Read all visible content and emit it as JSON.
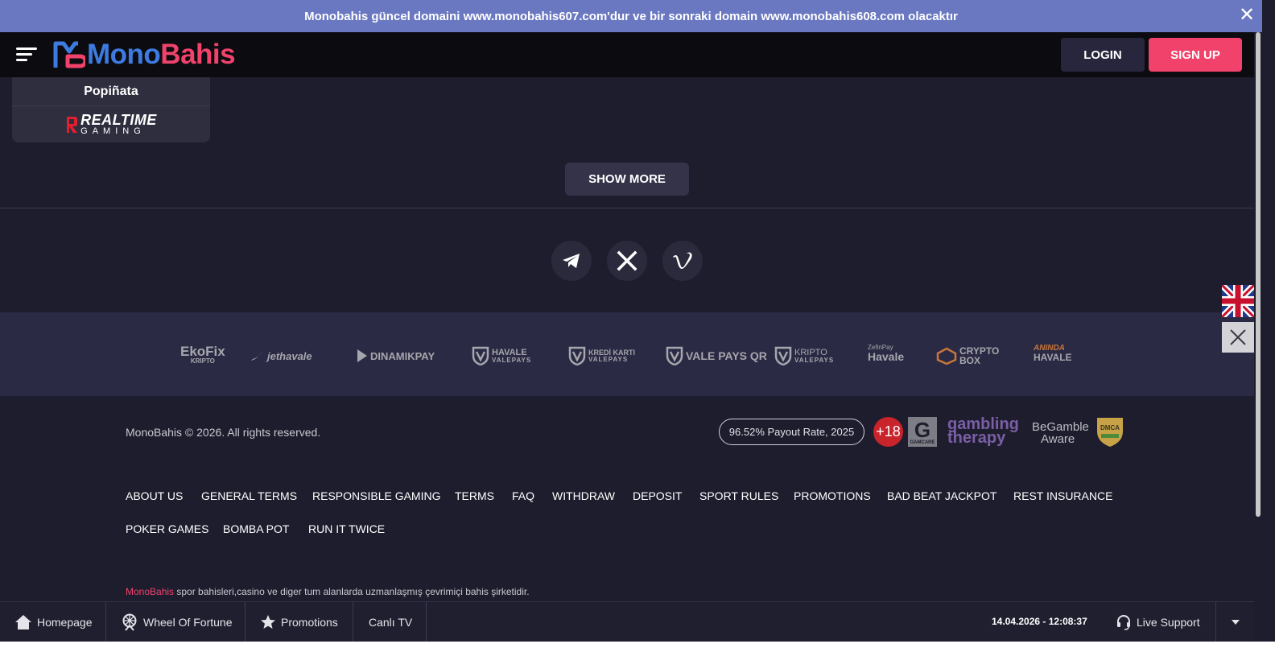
{
  "announcement": {
    "text": "Monobahis güncel domaini www.monobahis607.com'dur ve bir sonraki domain www.monobahis608.com olacaktır",
    "close_label": "✕"
  },
  "header": {
    "logo_mono": "Mono",
    "logo_bahis": "Bahis",
    "login_label": "LOGIN",
    "signup_label": "SIGN UP"
  },
  "providers": {
    "items": [
      "Popiñata"
    ],
    "rtg_line1": "REALTIME",
    "rtg_line2": "GAMING"
  },
  "show_more_label": "SHOW MORE",
  "social": [
    "telegram-icon",
    "x-icon",
    "vimeo-icon"
  ],
  "payments": [
    {
      "name": "EkoFix",
      "sub": "KRIPTO"
    },
    {
      "name": "jethavale"
    },
    {
      "name": "DINAMIKPAY"
    },
    {
      "name": "HAVALE",
      "sub": "VALEPAYS"
    },
    {
      "name": "KREDİ KARTI",
      "sub": "VALEPAYS"
    },
    {
      "name": "VALE PAYS QR"
    },
    {
      "name": "KRIPTO",
      "sub": "VALEPAYS"
    },
    {
      "name": "ZefinPay",
      "sub": "Havale"
    },
    {
      "name": "CRYPTO",
      "sub": "BOX"
    },
    {
      "name": "ANINDA",
      "sub": "HAVALE"
    }
  ],
  "footer": {
    "copyright": "MonoBahis © 2026. All rights reserved.",
    "payout": "96.52% Payout Rate, 2025",
    "age_badge": "+18",
    "gamcare_letter": "G",
    "gamcare_label": "GAMCARE",
    "gambling_therapy_1": "gambling",
    "gambling_therapy_2": "therapy",
    "begamble_1": "BeGamble",
    "begamble_2": "Aware",
    "dmca_label": "DMCA",
    "links_row1": [
      "ABOUT US",
      "GENERAL TERMS",
      "RESPONSIBLE GAMING",
      "TERMS",
      "FAQ",
      "WITHDRAW",
      "DEPOSIT",
      "SPORT RULES",
      "PROMOTIONS",
      "BAD BEAT JACKPOT",
      "REST INSURANCE"
    ],
    "links_row2": [
      "POKER GAMES",
      "BOMBA POT",
      "RUN IT TWICE"
    ],
    "tagline_brand": "MonoBahis",
    "tagline_rest": " spor bahisleri,casino ve diger tum alanlarda uzmanlaşmış çevrimiçi bahis şirketidir."
  },
  "bottombar": {
    "homepage": "Homepage",
    "wheel": "Wheel Of Fortune",
    "promotions": "Promotions",
    "canli_tv": "Canlı TV",
    "datetime": "14.04.2026 - 12:08:37",
    "live_support": "Live Support"
  },
  "colors": {
    "announce_bg": "#6a78c2",
    "accent": "#f0426b",
    "brand_blue": "#3d7be0",
    "bg": "#1e1d2e"
  }
}
